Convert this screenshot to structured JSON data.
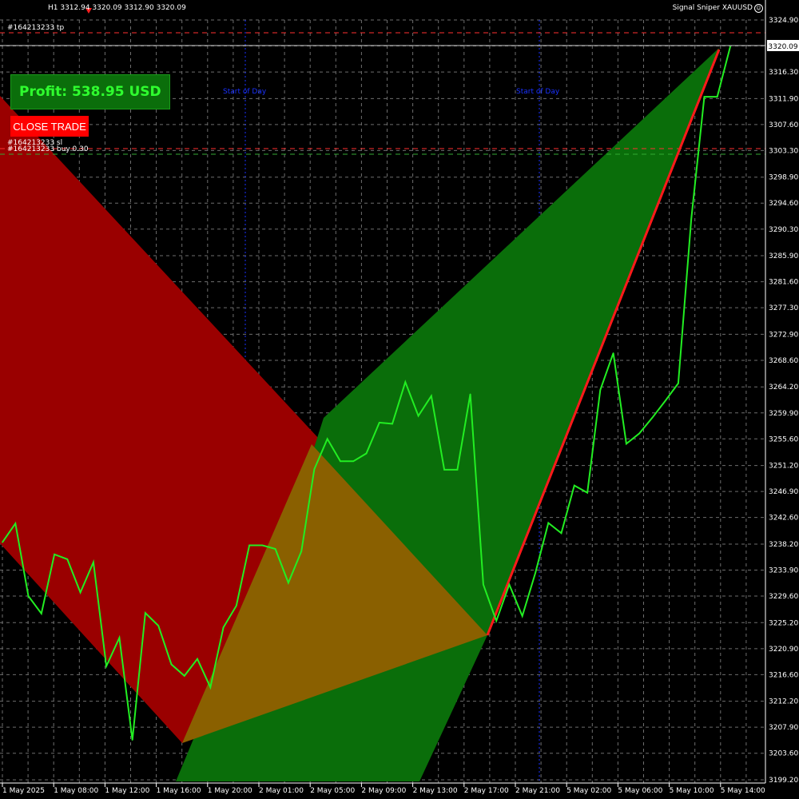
{
  "header": {
    "symbol_info": "H1  3312.94 3320.09 3312.90 3320.09",
    "indicator_name": "Signal Sniper XAUUSD",
    "indicator_icon": "smiley-icon"
  },
  "orders": {
    "tp_label": "#164213233 tp",
    "sl_label": "#164213233 sl",
    "buy_label": "#164213233 buy 0.30"
  },
  "panel": {
    "profit_text": "Profit: 538.95 USD",
    "close_button": "CLOSE TRADE"
  },
  "annotations": {
    "start_of_day": "Start of Day"
  },
  "colors": {
    "background": "#000000",
    "grid": "#6e6e6e",
    "price_line": "#22ee22",
    "sl_zone": "#9a0000",
    "tp_zone": "#0a6e0a",
    "overlap_zone": "#8a6000",
    "trend_line": "#ff1a1a",
    "tp_level": "#ff3030",
    "sl_level": "#33aa33",
    "day_separator": "#1a32ff"
  },
  "chart_data": {
    "type": "line",
    "timeframe": "H1",
    "y_ticks": [
      "3324.90",
      "3320.60",
      "3316.30",
      "3311.90",
      "3307.60",
      "3303.30",
      "3298.90",
      "3294.60",
      "3290.30",
      "3285.90",
      "3281.60",
      "3277.30",
      "3272.90",
      "3268.60",
      "3264.20",
      "3259.90",
      "3255.60",
      "3251.20",
      "3246.90",
      "3242.60",
      "3238.20",
      "3233.90",
      "3229.60",
      "3225.20",
      "3220.90",
      "3216.60",
      "3212.20",
      "3207.90",
      "3203.60",
      "3199.20"
    ],
    "x_ticks": [
      "1 May 2025",
      "1 May 08:00",
      "1 May 12:00",
      "1 May 16:00",
      "1 May 20:00",
      "2 May 01:00",
      "2 May 05:00",
      "2 May 09:00",
      "2 May 13:00",
      "2 May 17:00",
      "2 May 21:00",
      "5 May 02:00",
      "5 May 06:00",
      "5 May 10:00",
      "5 May 14:00"
    ],
    "ylim": [
      3199.2,
      3324.9
    ],
    "current_price": "3320.09",
    "tp_price": 3322.5,
    "sl_price": 3302.3,
    "entry_price": 3222.5,
    "series": [
      {
        "values": [
          3238.5,
          3241.6,
          3229.6,
          3226.7,
          3236.5,
          3235.7,
          3230.2,
          3235.2,
          3218.0,
          3222.7,
          3205.8,
          3226.8,
          3224.7,
          3218.3,
          3216.4,
          3219.2,
          3214.5,
          3224.4,
          3228.0,
          3238.0,
          3238.0,
          3237.4,
          3231.8,
          3237.0,
          3250.6,
          3255.6,
          3251.9,
          3251.9,
          3253.2,
          3258.3,
          3258.1,
          3265.0,
          3259.4,
          3262.7,
          3250.5,
          3250.5,
          3263.0,
          3231.5,
          3225.5,
          3231.5,
          3226.3,
          3233.4,
          3241.7,
          3240.0,
          3247.9,
          3246.7,
          3263.7,
          3269.8,
          3254.8,
          3256.5,
          3259.1,
          3261.9,
          3264.8,
          3292.0,
          3312.2,
          3312.2,
          3320.5
        ]
      }
    ]
  }
}
